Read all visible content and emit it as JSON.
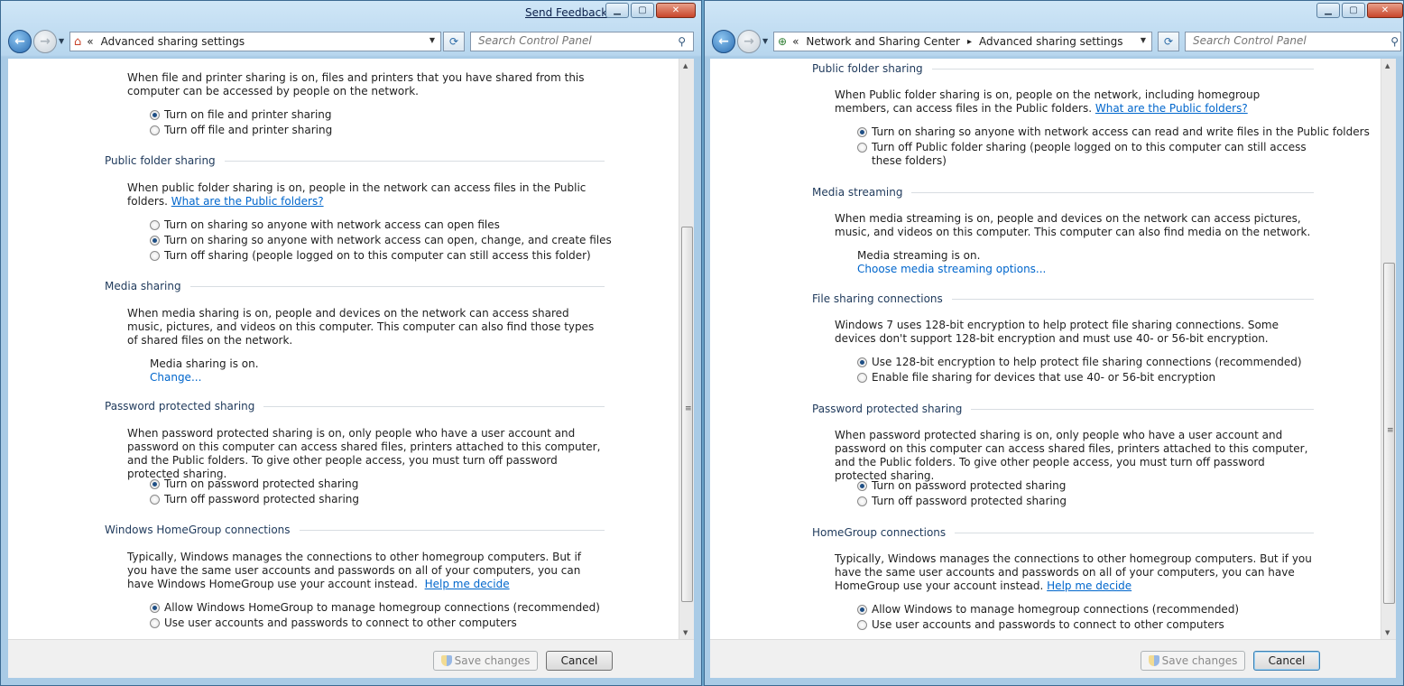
{
  "left": {
    "send_feedback": "Send Feedback",
    "breadcrumb_prefix": "«",
    "address": "Advanced sharing settings",
    "search_placeholder": "Search Control Panel",
    "sections": {
      "file_printer": {
        "desc": "When file and printer sharing is on, files and printers that you have shared from this computer can be accessed by people on the network.",
        "opt1": "Turn on file and printer sharing",
        "opt2": "Turn off file and printer sharing"
      },
      "public": {
        "title": "Public folder sharing",
        "desc": "When public folder sharing is on, people in the network can access files in the Public folders.",
        "link": "What are the Public folders?",
        "opt1": "Turn on sharing so anyone with network access can open files",
        "opt2": "Turn on sharing so anyone with network access can open, change, and create files",
        "opt3": "Turn off sharing (people logged on to this computer can still access this folder)"
      },
      "media": {
        "title": "Media sharing",
        "desc": "When media sharing is on, people and devices on the network can access shared music, pictures, and videos on this computer. This computer can also find those types of shared files on the network.",
        "status": "Media sharing is on.",
        "link": "Change..."
      },
      "password": {
        "title": "Password protected sharing",
        "desc": "When password protected sharing is on, only people who have a user account and password on this computer can access shared files, printers attached to this computer, and the Public folders. To give other people access, you must turn off password protected sharing.",
        "opt1": "Turn on password protected sharing",
        "opt2": "Turn off password protected sharing"
      },
      "homegroup": {
        "title": "Windows HomeGroup connections",
        "desc": "Typically, Windows manages the connections to other homegroup computers.  But if you have the same user accounts and passwords on all of your computers, you can have Windows HomeGroup use your account instead.",
        "link": "Help me decide",
        "opt1": "Allow Windows HomeGroup to manage homegroup connections (recommended)",
        "opt2": "Use user accounts and passwords to connect to other computers"
      }
    },
    "save": "Save changes",
    "cancel": "Cancel"
  },
  "right": {
    "breadcrumb_prefix": "«",
    "crumb1": "Network and Sharing Center",
    "crumb_sep": "▸",
    "crumb2": "Advanced sharing settings",
    "search_placeholder": "Search Control Panel",
    "sections": {
      "public": {
        "title": "Public folder sharing",
        "desc": "When Public folder sharing is on, people on the network, including homegroup members, can access files in the Public folders.",
        "link": "What are the Public folders?",
        "opt1": "Turn on sharing so anyone with network access can read and write files in the Public folders",
        "opt2": "Turn off Public folder sharing (people logged on to this computer can still access these folders)"
      },
      "media": {
        "title": "Media streaming",
        "desc": "When media streaming is on, people and devices on the network can access pictures, music, and videos on this computer. This computer can also find media on the network.",
        "status": "Media streaming is on.",
        "link": "Choose media streaming options..."
      },
      "filesharing": {
        "title": "File sharing connections",
        "desc": "Windows 7 uses 128-bit encryption to help protect file sharing connections. Some devices don't support 128-bit encryption and must use 40- or 56-bit encryption.",
        "opt1": "Use 128-bit encryption to help protect file sharing connections (recommended)",
        "opt2": "Enable file sharing for devices that use 40- or 56-bit encryption"
      },
      "password": {
        "title": "Password protected sharing",
        "desc": "When password protected sharing is on, only people who have a user account and password on this computer can access shared files, printers attached to this computer, and the Public folders. To give other people access, you must turn off password protected sharing.",
        "opt1": "Turn on password protected sharing",
        "opt2": "Turn off password protected sharing"
      },
      "homegroup": {
        "title": "HomeGroup connections",
        "desc": "Typically, Windows manages the connections to other homegroup computers. But if you have the same user accounts and passwords on all of your computers, you can have HomeGroup use your account instead.",
        "link": "Help me decide",
        "opt1": "Allow Windows to manage homegroup connections (recommended)",
        "opt2": "Use user accounts and passwords to connect to other computers"
      }
    },
    "save": "Save changes",
    "cancel": "Cancel"
  },
  "icons": {
    "back": "back-arrow-icon",
    "forward": "forward-arrow-icon",
    "search": "magnifier-icon",
    "shield": "uac-shield-icon"
  }
}
